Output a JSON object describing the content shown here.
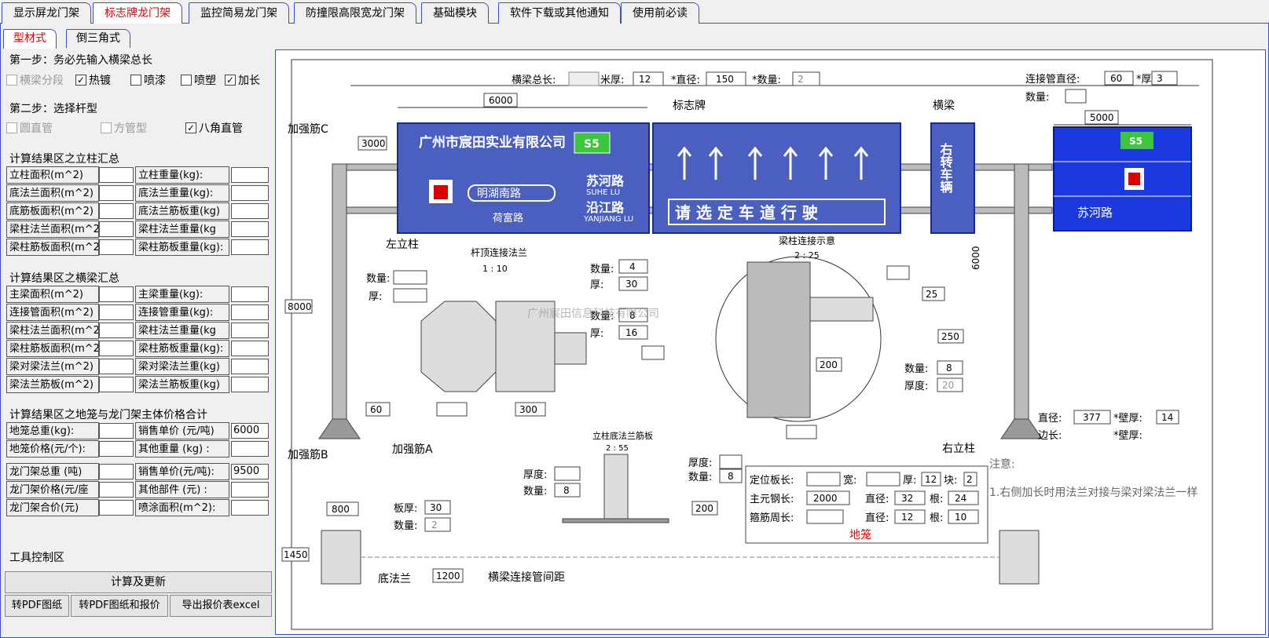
{
  "tabs": [
    "显示屏龙门架",
    "标志牌龙门架",
    "监控简易龙门架",
    "防撞限高限宽龙门架",
    "基础模块",
    "软件下载或其他通知",
    "使用前必读"
  ],
  "subtabs": [
    "型材式",
    "倒三角式"
  ],
  "step1": {
    "title": "第一步：务必先输入横梁总长",
    "opts": [
      "横梁分段",
      "热镀",
      "喷漆",
      "喷塑",
      "加长"
    ]
  },
  "step2": {
    "title": "第二步：选择杆型",
    "opts": [
      "圆直管",
      "方管型",
      "八角直管"
    ]
  },
  "sec1": {
    "title": "计算结果区之立柱汇总",
    "rows": [
      [
        "立柱面积(m^2)",
        "立柱重量(kg):"
      ],
      [
        "底法兰面积(m^2)",
        "底法兰重量(kg):"
      ],
      [
        "底筋板面积(m^2)",
        "底法兰筋板重(kg)"
      ],
      [
        "梁柱法兰面积(m^2",
        "梁柱法兰重量(kg"
      ],
      [
        "梁柱筋板面积(m^2",
        "梁柱筋板重量(kg):"
      ]
    ]
  },
  "sec2": {
    "title": "计算结果区之横梁汇总",
    "rows": [
      [
        "主梁面积(m^2)",
        "主梁重量(kg):"
      ],
      [
        "连接管面积(m^2)",
        "连接管重量(kg):"
      ],
      [
        "梁柱法兰面积(m^2",
        "梁柱法兰重量(kg"
      ],
      [
        "梁柱筋板面积(m^2",
        "梁柱筋板重量(kg):"
      ],
      [
        "梁对梁法兰(m^2)",
        "梁对梁法兰重(kg)"
      ],
      [
        "梁法兰筋板(m^2)",
        "梁法兰筋板重(kg)"
      ]
    ]
  },
  "sec3": {
    "title": "计算结果区之地笼与龙门架主体价格合计",
    "rowsA": [
      [
        "地笼总重(kg):",
        "销售单价 (元/吨)",
        "6000"
      ],
      [
        "地笼价格(元/个):",
        "其他重量 (kg) :",
        ""
      ]
    ],
    "rowsB": [
      [
        "龙门架总重 (吨)",
        "销售单价(元/吨):",
        "9500"
      ],
      [
        "龙门架价格(元/座",
        "其他部件 (元) :",
        ""
      ],
      [
        "龙门架合价(元)",
        "喷涂面积(m^2):",
        ""
      ]
    ]
  },
  "tools": {
    "title": "工具控制区",
    "calc": "计算及更新",
    "pdf": "转PDF图纸",
    "pdf_quote": "转PDF图纸和报价",
    "export": "导出报价表excel"
  },
  "drawing": {
    "beam_len": "横梁总长:",
    "mi_hou": "米厚:",
    "thick": "12",
    "zhijing": "*直径:",
    "dia": "150",
    "shuliang": "*数量:",
    "qty": "2",
    "conn_dia_label": "连接管直径:",
    "conn_dia": "60",
    "conn_thick_label": "*厚",
    "conn_thick": "3",
    "conn_qty_label": "数量:",
    "d6000": "6000",
    "d5000": "5000",
    "d3000": "3000",
    "d8000": "8000",
    "d6000v": "6000",
    "biaozhipai": "标志牌",
    "hengliang": "横梁",
    "jqj_c": "加强筋C",
    "zuolizhu": "左立柱",
    "youlizhu": "右立柱",
    "jqj_b": "加强筋B",
    "jqj_a": "加强筋A",
    "sign1_company": "广州市宸田实业有限公司",
    "sign1_s5": "S5",
    "sign1_road1": "明湖南路",
    "sign1_road2": "苏河路",
    "sign1_road2en": "SUHE LU",
    "sign1_road3": "沿江路",
    "sign1_road3en": "YANJIANG LU",
    "sign1_road4": "荷富路",
    "sign2_text": "请 选 定 车 道 行 驶",
    "sign3_text": "右转车辆",
    "sign4_road": "苏河路",
    "flange_top": "杆顶连接法兰",
    "flange_scale": "1 : 10",
    "shuliang2": "数量:",
    "hou": "厚:",
    "n4": "4",
    "n30": "30",
    "n8": "8",
    "n16": "16",
    "n60": "60",
    "n300": "300",
    "beam_col": "梁柱连接示意",
    "beam_scale": "2 : 25",
    "n25": "25",
    "n250": "250",
    "n200": "200",
    "n8b": "8",
    "houdu": "厚度:",
    "n20": "20",
    "col_base": "立柱底法兰筋板",
    "base_scale": "2 : 55",
    "n8c": "8",
    "n200b": "200",
    "n8d": "8",
    "dia2_label": "直径:",
    "dia2": "377",
    "wall_label": "*壁厚:",
    "wall": "14",
    "edge_label": "边长:",
    "wall2_label": "*壁厚:",
    "note_title": "注意:",
    "note1": "1.右侧加长时用法兰对接与梁对梁法兰一样",
    "n800": "800",
    "n1450": "1450",
    "banhou": "板厚:",
    "n30b": "30",
    "n2": "2",
    "difalan": "底法兰",
    "n1200": "1200",
    "conn_spacing": "横梁连接管间距",
    "cage": {
      "dw": "定位板长:",
      "kuan": "宽:",
      "hou": "厚:",
      "hou_v": "12",
      "kuai": "块:",
      "kuai_v": "2",
      "zy": "主元钢长:",
      "zy_v": "2000",
      "zj": "直径:",
      "zj_v": "32",
      "gen": "根:",
      "gen_v": "24",
      "gj": "箍筋周长:",
      "zj2_v": "12",
      "gen2_v": "10",
      "title": "地笼"
    },
    "watermark": "广州宸田信息科技有限公司"
  }
}
